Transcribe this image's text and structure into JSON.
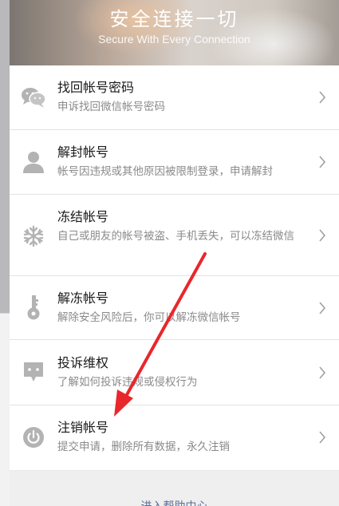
{
  "banner": {
    "title": "安全连接一切",
    "subtitle": "Secure With Every Connection"
  },
  "items": [
    {
      "label": "找回帐号密码",
      "desc": "申诉找回微信帐号密码",
      "icon": "chat-bubbles-icon"
    },
    {
      "label": "解封帐号",
      "desc": "帐号因违规或其他原因被限制登录，申请解封",
      "icon": "person-icon"
    },
    {
      "label": "冻结帐号",
      "desc": "自己或朋友的帐号被盗、手机丢失，可以冻结微信",
      "icon": "snowflake-icon"
    },
    {
      "label": "解冻帐号",
      "desc": "解除安全风险后，你可以解冻微信帐号",
      "icon": "key-icon"
    },
    {
      "label": "投诉维权",
      "desc": "了解如何投诉违规或侵权行为",
      "icon": "complaint-icon"
    },
    {
      "label": "注销帐号",
      "desc": "提交申请，删除所有数据，永久注销",
      "icon": "power-icon"
    }
  ],
  "footer": {
    "link": "进入帮助中心"
  },
  "colors": {
    "icon": "#b3b3b3",
    "arrow": "#e8272c",
    "link": "#5b6f96"
  }
}
